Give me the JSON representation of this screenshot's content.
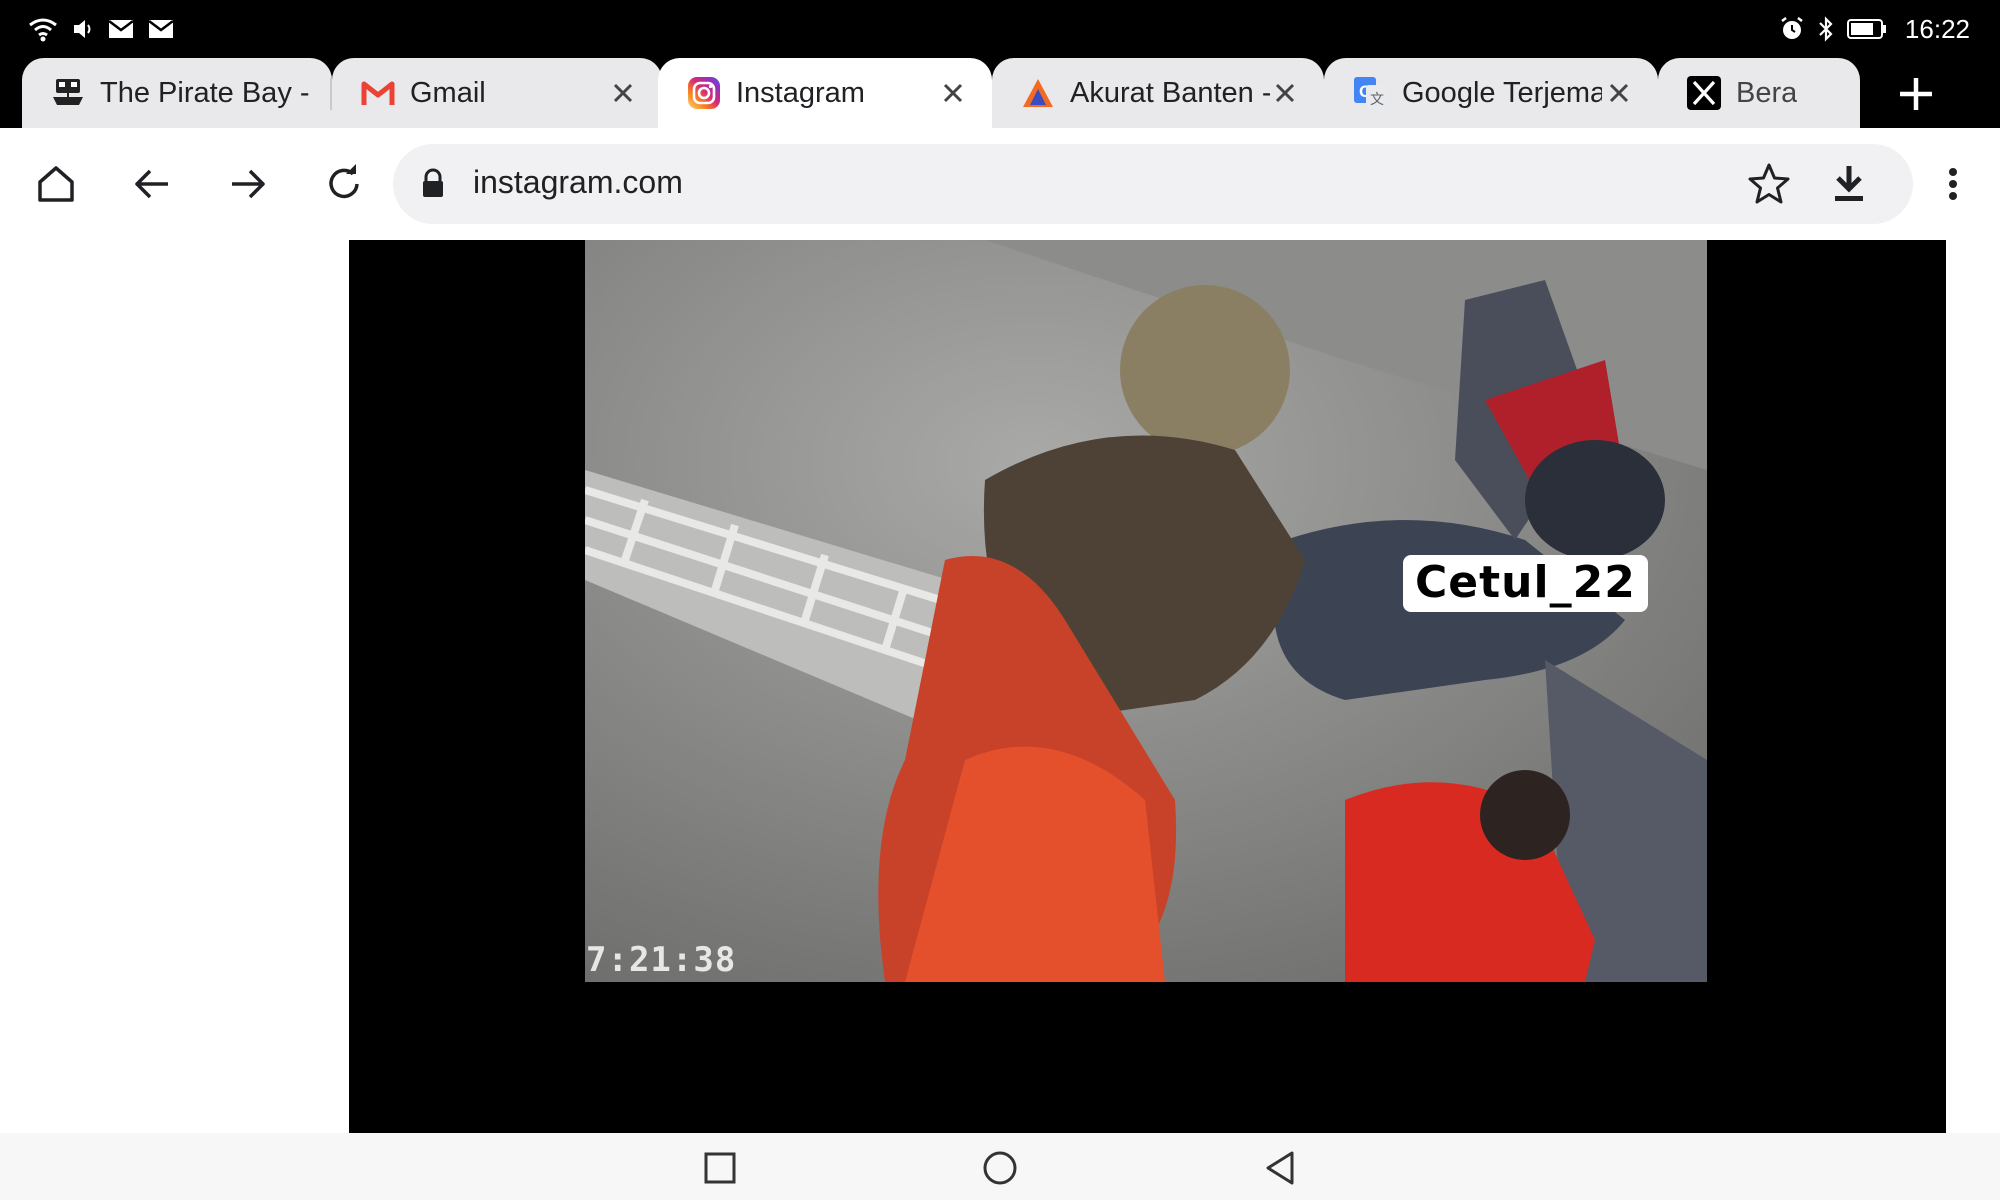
{
  "status_bar": {
    "time": "16:22",
    "left_icons": [
      "wifi-icon",
      "volume-icon",
      "mail-icon",
      "mail-icon"
    ],
    "right_icons": [
      "alarm-icon",
      "bluetooth-icon",
      "battery-icon"
    ]
  },
  "tabs": [
    {
      "title": "The Pirate Bay -",
      "icon": "pirate-ship-icon",
      "active": false
    },
    {
      "title": "Gmail",
      "icon": "gmail-icon",
      "active": false
    },
    {
      "title": "Instagram",
      "icon": "instagram-icon",
      "active": true
    },
    {
      "title": "Akurat Banten -",
      "icon": "akurat-icon",
      "active": false
    },
    {
      "title": "Google Terjemah",
      "icon": "google-translate-icon",
      "active": false
    },
    {
      "title": "Bera",
      "icon": "x-logo-icon",
      "active": false
    }
  ],
  "toolbar": {
    "url": "instagram.com",
    "buttons": [
      "home-icon",
      "back-icon",
      "forward-icon",
      "reload-icon",
      "star-icon",
      "download-icon",
      "more-icon"
    ]
  },
  "video": {
    "watermark": "Cetul_22",
    "timestamp": "7:21:38"
  },
  "nav": {
    "buttons": [
      "recents-icon",
      "home-circle-icon",
      "back-triangle-icon"
    ]
  },
  "colors": {
    "statusbar_bg": "#000000",
    "tab_inactive_bg": "#e9e9ec",
    "tab_active_bg": "#ffffff",
    "omnibox_bg": "#f1f1f3",
    "gmail_red": "#ea4335",
    "instagram_gradient": [
      "#feda75",
      "#fa7e1e",
      "#d62976",
      "#962fbf",
      "#4f5bd5"
    ],
    "akurat_orange": "#f26b21"
  }
}
